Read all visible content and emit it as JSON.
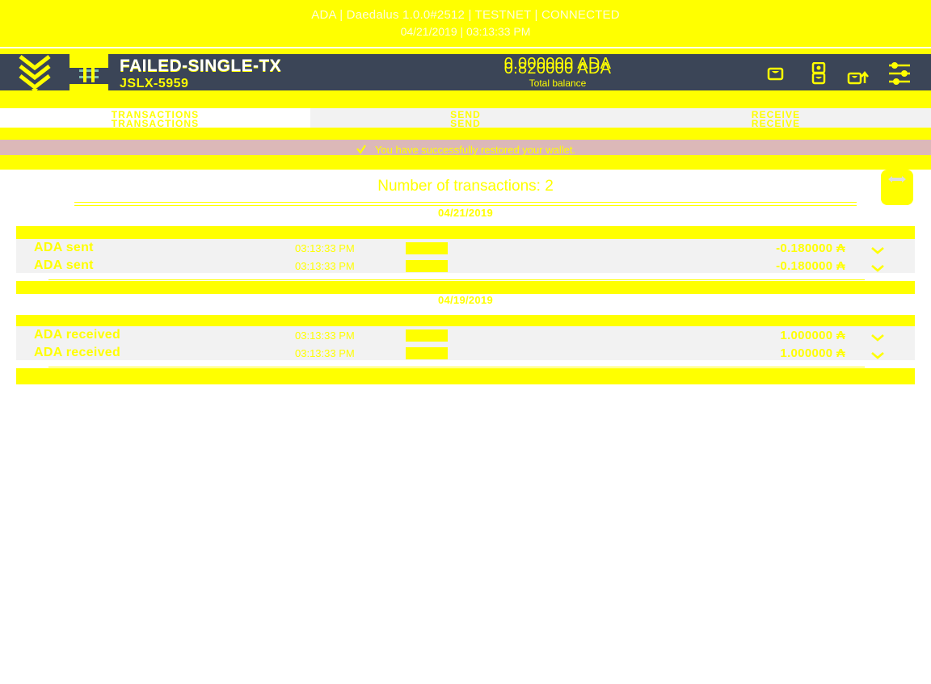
{
  "titlebar": {
    "line1": "ADA | Daedalus 1.0.0#2512 | TESTNET | CONNECTED",
    "line2": "04/21/2019 | 03:13:33 PM"
  },
  "navbar": {
    "logo_icon": "daedalus-logo-icon",
    "menu_icon": "wallet-switch-icon",
    "wallet_name": "FAILED-SINGLE-TX",
    "wallet_name_ghost": "FAILED-SINGLE-TX",
    "wallet_sub": "JSLX-5959",
    "amount_primary": "0.820000 ADA",
    "amount_ghost": "0.000000 ADA",
    "amount_label": "Total balance",
    "icons": [
      {
        "name": "wallets-icon",
        "label": "Wallets"
      },
      {
        "name": "ada-redemption-icon",
        "label": "ADA Redemption"
      },
      {
        "name": "paper-wallet-icon",
        "label": "Paper Wallet"
      },
      {
        "name": "settings-sliders-icon",
        "label": "Settings"
      }
    ]
  },
  "tabs": [
    {
      "label": "TRANSACTIONS",
      "active": true
    },
    {
      "label": "SEND",
      "active": false
    },
    {
      "label": "RECEIVE",
      "active": false
    }
  ],
  "notification": {
    "icon": "check-icon",
    "text": "You have successfully restored your wallet.",
    "ghost_text": "You have successfully restored your wallet."
  },
  "transactions_panel": {
    "header": "Number of transactions: 2",
    "scroll_icon": "resize-handle-icon",
    "groups": [
      {
        "date": "04/21/2019",
        "rows": [
          {
            "title": "ADA sent",
            "title_ghost": "ADA sent",
            "time": "03:13:33 PM",
            "time_ghost": "03:13:33 PM",
            "badge": "pending-badge",
            "amount": "-0.180000 ₳",
            "amount_ghost": "-0.180000 ₳",
            "expand_icon": "chevron-down-icon"
          }
        ]
      },
      {
        "date": "04/19/2019",
        "rows": [
          {
            "title": "ADA received",
            "title_ghost": "ADA received",
            "time": "03:13:33 PM",
            "time_ghost": "03:13:33 PM",
            "badge": "pending-badge",
            "amount": "1.000000 ₳",
            "amount_ghost": "1.000000 ₳",
            "expand_icon": "chevron-down-icon"
          }
        ]
      }
    ]
  },
  "colors": {
    "accent_yellow": "#ffff00",
    "navbar_dark": "#3b4557",
    "notification_bg": "#dcb8b8",
    "row_bg": "#f2f2f2",
    "tab_inactive_bg": "#f2f2f2",
    "tab_active_bg": "#ffffff"
  }
}
